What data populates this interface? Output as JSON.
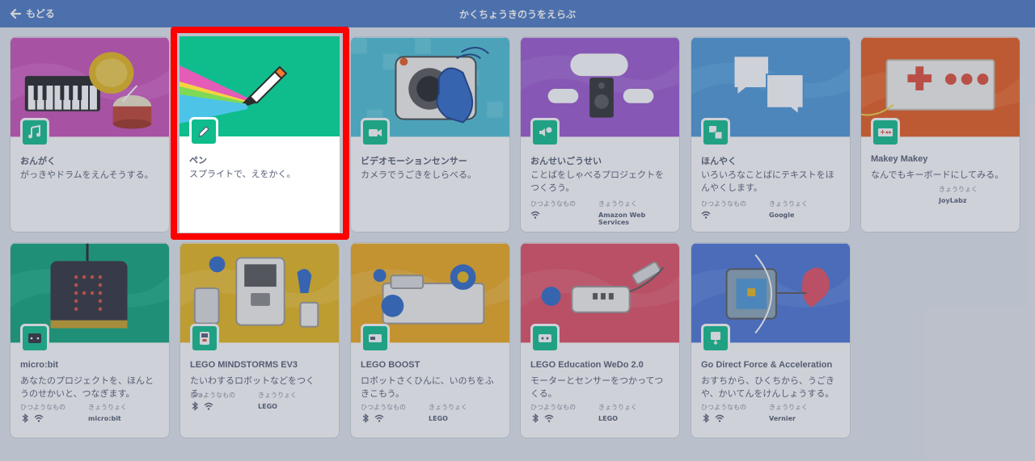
{
  "header": {
    "back_label": "もどる",
    "title": "かくちょうきのうをえらぶ"
  },
  "labels": {
    "requires": "ひつようなもの",
    "collab": "きょうりょく"
  },
  "cards": [
    {
      "id": "music",
      "name": "おんがく",
      "desc": "がっきやドラムをえんそうする。",
      "collab": "",
      "art_bg": "#c94fb8"
    },
    {
      "id": "pen",
      "name": "ペン",
      "desc": "スプライトで、えをかく。",
      "collab": "",
      "art_bg": "#0fbd8c"
    },
    {
      "id": "video",
      "name": "ビデオモーションセンサー",
      "desc": "カメラでうごきをしらべる。",
      "collab": "",
      "art_bg": "#4cbfd6"
    },
    {
      "id": "tts",
      "name": "おんせいごうせい",
      "desc": "ことばをしゃべるプロジェクトをつくろう。",
      "collab": "Amazon Web Services",
      "art_bg": "#9b57d0"
    },
    {
      "id": "translate",
      "name": "ほんやく",
      "desc": "いろいろなことばにテキストをほんやくします。",
      "collab": "Google",
      "art_bg": "#4c97d8"
    },
    {
      "id": "makey",
      "name": "Makey Makey",
      "desc": "なんでもキーボードにしてみる。",
      "collab": "JoyLabz",
      "art_bg": "#e85a1e"
    },
    {
      "id": "microbit",
      "name": "micro:bit",
      "desc": "あなたのプロジェクトを、ほんとうのせかいと、つなぎます。",
      "collab": "micro:bit",
      "art_bg": "#0fa47a"
    },
    {
      "id": "ev3",
      "name": "LEGO MINDSTORMS EV3",
      "desc": "たいわするロボットなどをつくる。",
      "collab": "LEGO",
      "art_bg": "#e8b61a"
    },
    {
      "id": "boost",
      "name": "LEGO BOOST",
      "desc": "ロボットさくひんに、いのちをふきこもう。",
      "collab": "LEGO",
      "art_bg": "#f0a81a"
    },
    {
      "id": "wedo",
      "name": "LEGO Education WeDo 2.0",
      "desc": "モーターとセンサーをつかってつくる。",
      "collab": "LEGO",
      "art_bg": "#e24d62"
    },
    {
      "id": "force",
      "name": "Go Direct Force & Acceleration",
      "desc": "おすちから、ひくちから、うごきや、かいてんをけんしょうする。",
      "collab": "Vernier",
      "art_bg": "#4a74d6"
    }
  ],
  "colors": {
    "topbar": "#4c79c4",
    "highlight": "#ff0000",
    "badge": "#0fbd8c"
  }
}
